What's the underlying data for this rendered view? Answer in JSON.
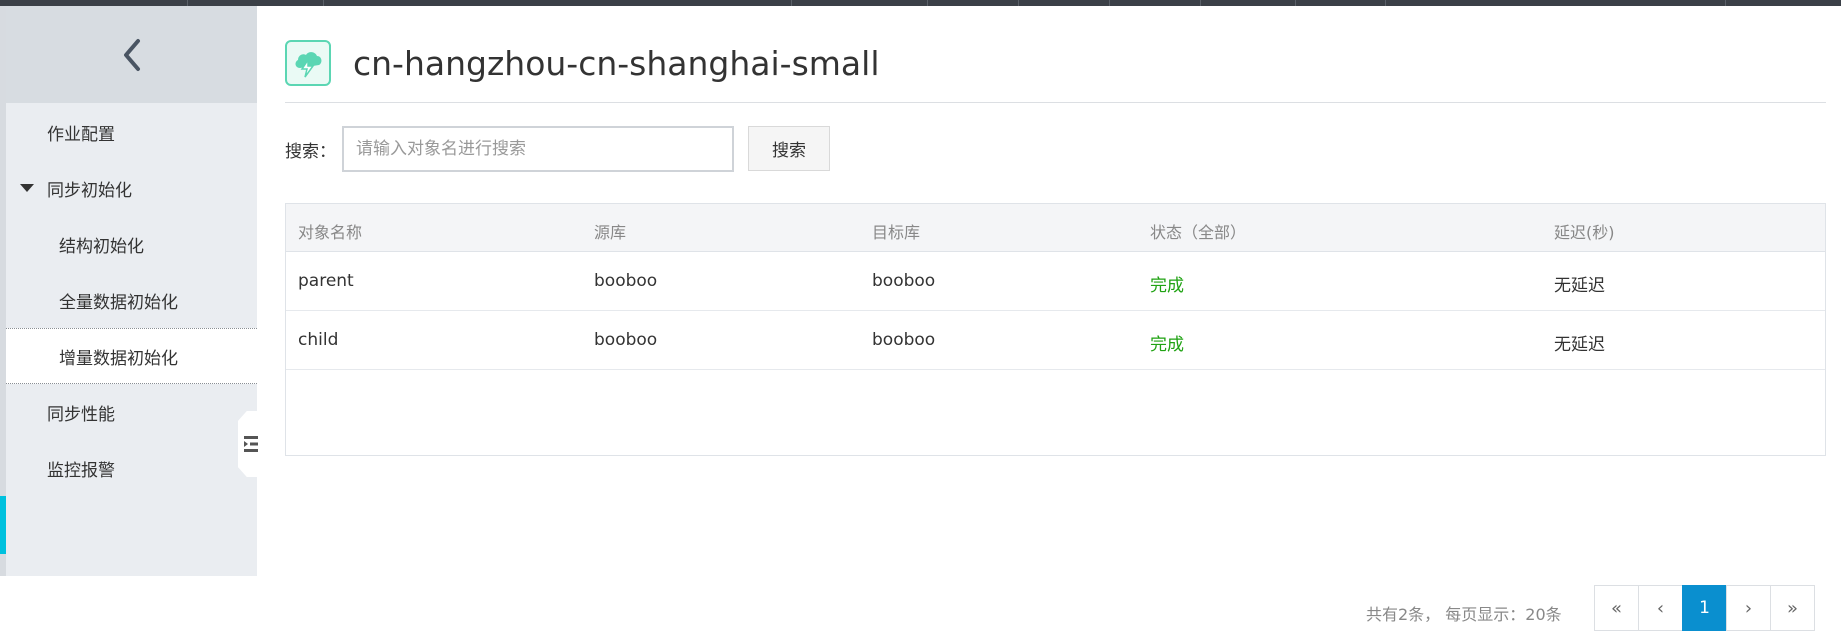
{
  "window": {
    "title": "cn-hangzhou-cn-shanghai-small"
  },
  "sidebar": {
    "back_icon": "chevron-left-icon",
    "items": [
      {
        "label": "作业配置",
        "level": 1
      },
      {
        "label": "同步初始化",
        "level": 1,
        "expanded": true
      },
      {
        "label": "结构初始化",
        "level": 2
      },
      {
        "label": "全量数据初始化",
        "level": 2
      },
      {
        "label": "增量数据初始化",
        "level": 2,
        "active": true
      },
      {
        "label": "同步性能",
        "level": 1
      },
      {
        "label": "监控报警",
        "level": 1
      }
    ]
  },
  "search": {
    "label": "搜索：",
    "placeholder": "请输入对象名进行搜索",
    "value": "",
    "button_label": "搜索"
  },
  "table": {
    "columns": [
      "对象名称",
      "源库",
      "目标库",
      "状态（全部）",
      "延迟(秒)"
    ],
    "rows": [
      {
        "name": "parent",
        "source": "booboo",
        "target": "booboo",
        "status": "完成",
        "delay": "无延迟"
      },
      {
        "name": "child",
        "source": "booboo",
        "target": "booboo",
        "status": "完成",
        "delay": "无延迟"
      }
    ]
  },
  "pagination": {
    "info": "共有2条， 每页显示：20条",
    "first": "«",
    "prev": "‹",
    "current_page": "1",
    "next": "›",
    "last": "»"
  },
  "colors": {
    "accent": "#0a8fcf",
    "status_done": "#1fa212",
    "sidebar_bg": "#eaedf1",
    "logo": "#5bd6b3"
  }
}
